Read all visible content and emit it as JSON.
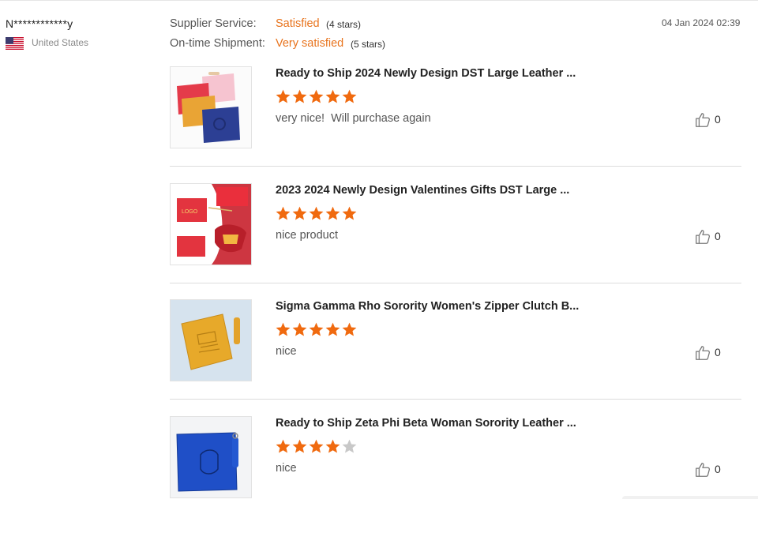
{
  "reviewer": {
    "name": "N************y",
    "country": "United States",
    "date": "04 Jan 2024 02:39"
  },
  "ratings": [
    {
      "label": "Supplier Service:",
      "value": "Satisfied",
      "stars": "(4 stars)"
    },
    {
      "label": "On-time Shipment:",
      "value": "Very satisfied",
      "stars": "(5 stars)"
    }
  ],
  "colors": {
    "accent": "#e8731c",
    "star_filled": "#f06a0f",
    "star_empty": "#c8c8c8"
  },
  "products": [
    {
      "title": "Ready to Ship 2024 Newly Design DST Large Leather ...",
      "stars": 5,
      "comment": "very nice!  Will purchase again",
      "likes": "0"
    },
    {
      "title": "2023 2024 Newly Design Valentines Gifts DST Large ...",
      "stars": 5,
      "comment": "nice product",
      "likes": "0"
    },
    {
      "title": "Sigma Gamma Rho Sorority Women's Zipper Clutch B...",
      "stars": 5,
      "comment": "nice",
      "likes": "0"
    },
    {
      "title": "Ready to Ship Zeta Phi Beta Woman Sorority Leather ...",
      "stars": 4,
      "comment": "nice",
      "likes": "0"
    }
  ],
  "icons": {
    "like": "thumbs-up-icon",
    "flag": "us-flag-icon",
    "star": "star-icon"
  },
  "image_text": {
    "logo_tag": "LOGO"
  }
}
